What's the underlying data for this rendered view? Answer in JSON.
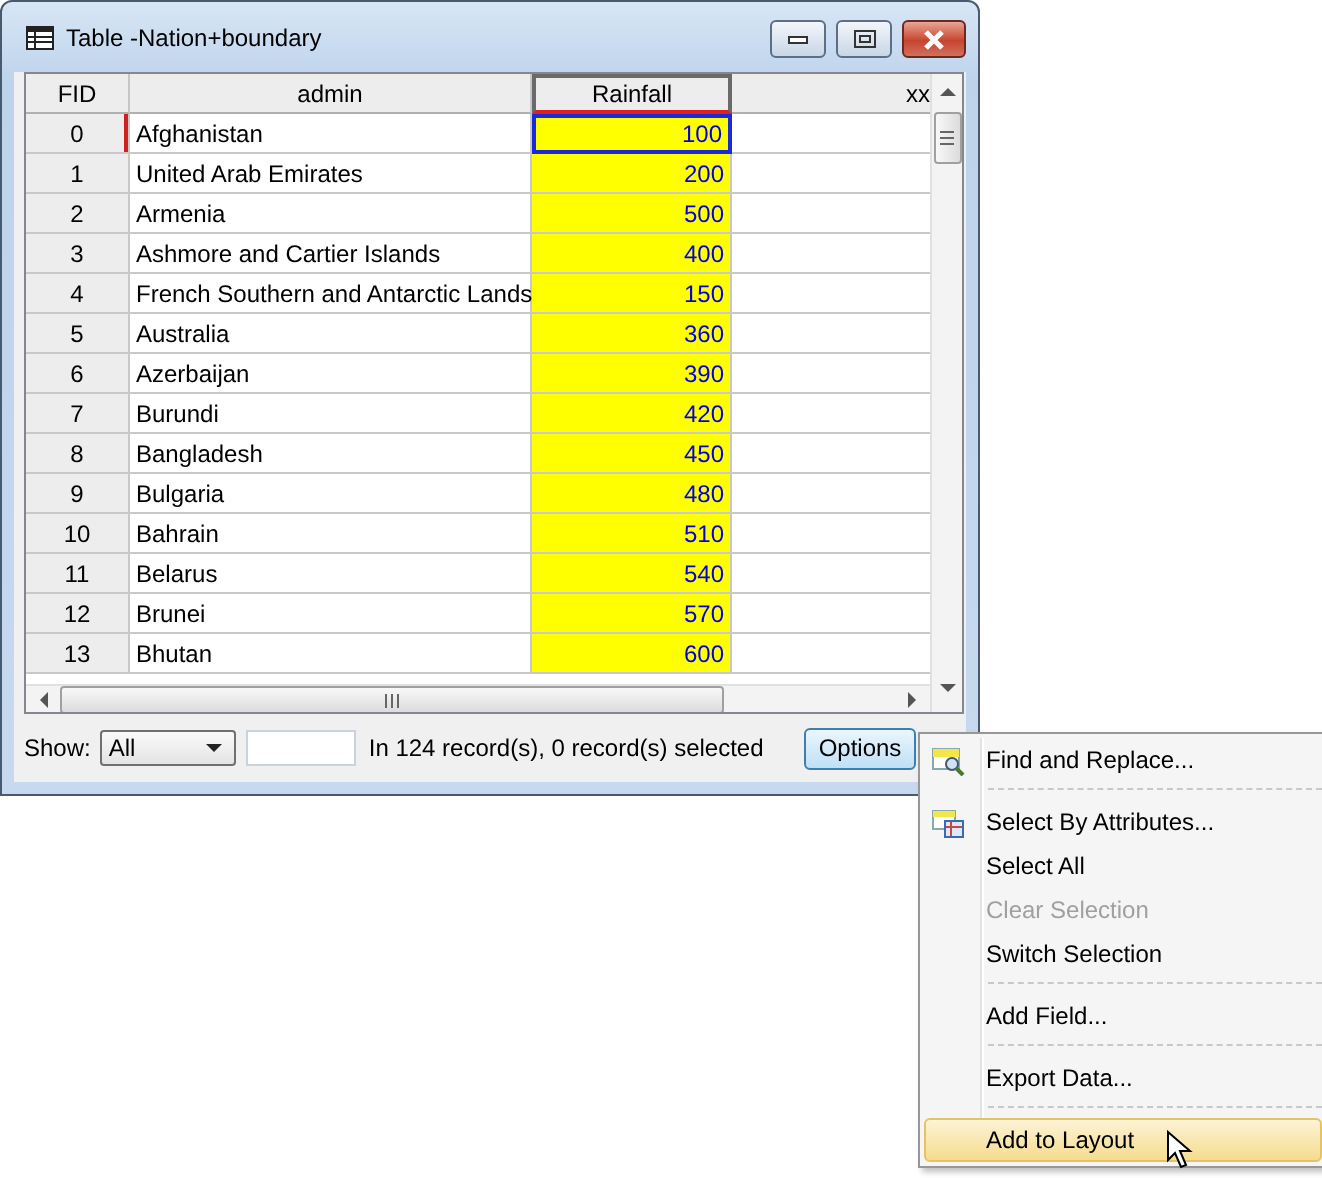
{
  "window": {
    "title": "Table -Nation+boundary"
  },
  "table": {
    "columns": [
      {
        "label": "FID",
        "kind": "id",
        "selected": false
      },
      {
        "label": "admin",
        "kind": "text",
        "selected": false
      },
      {
        "label": "Rainfall",
        "kind": "number",
        "selected": true
      },
      {
        "label": "xx",
        "kind": "text",
        "selected": false
      }
    ],
    "rows": [
      {
        "cells": [
          "0",
          "Afghanistan",
          "100",
          ""
        ],
        "focused": true
      },
      {
        "cells": [
          "1",
          "United Arab Emirates",
          "200",
          ""
        ],
        "focused": false
      },
      {
        "cells": [
          "2",
          "Armenia",
          "500",
          ""
        ],
        "focused": false
      },
      {
        "cells": [
          "3",
          "Ashmore and Cartier Islands",
          "400",
          ""
        ],
        "focused": false
      },
      {
        "cells": [
          "4",
          "French Southern and Antarctic Lands",
          "150",
          ""
        ],
        "focused": false
      },
      {
        "cells": [
          "5",
          "Australia",
          "360",
          ""
        ],
        "focused": false
      },
      {
        "cells": [
          "6",
          "Azerbaijan",
          "390",
          ""
        ],
        "focused": false
      },
      {
        "cells": [
          "7",
          "Burundi",
          "420",
          ""
        ],
        "focused": false
      },
      {
        "cells": [
          "8",
          "Bangladesh",
          "450",
          ""
        ],
        "focused": false
      },
      {
        "cells": [
          "9",
          "Bulgaria",
          "480",
          ""
        ],
        "focused": false
      },
      {
        "cells": [
          "10",
          "Bahrain",
          "510",
          ""
        ],
        "focused": false
      },
      {
        "cells": [
          "11",
          "Belarus",
          "540",
          ""
        ],
        "focused": false
      },
      {
        "cells": [
          "12",
          "Brunei",
          "570",
          ""
        ],
        "focused": false
      },
      {
        "cells": [
          "13",
          "Bhutan",
          "600",
          ""
        ],
        "focused": false
      }
    ]
  },
  "footer": {
    "show_label": "Show:",
    "show_value": "All",
    "status": "In 124 record(s), 0 record(s) selected",
    "options_button": "Options"
  },
  "menu": {
    "groups": [
      [
        {
          "label": "Find and Replace...",
          "kind": "find",
          "disabled": false,
          "selected": false
        }
      ],
      [
        {
          "label": "Select By Attributes...",
          "kind": "attributes",
          "disabled": false,
          "selected": false
        },
        {
          "label": "Select All",
          "kind": "plain",
          "disabled": false,
          "selected": false
        },
        {
          "label": "Clear Selection",
          "kind": "plain",
          "disabled": true,
          "selected": false
        },
        {
          "label": "Switch Selection",
          "kind": "plain",
          "disabled": false,
          "selected": false
        }
      ],
      [
        {
          "label": "Add Field...",
          "kind": "plain",
          "disabled": false,
          "selected": false
        }
      ],
      [
        {
          "label": "Export Data...",
          "kind": "plain",
          "disabled": false,
          "selected": false
        }
      ],
      [
        {
          "label": "Add to Layout",
          "kind": "plain",
          "disabled": false,
          "selected": true
        }
      ]
    ]
  }
}
